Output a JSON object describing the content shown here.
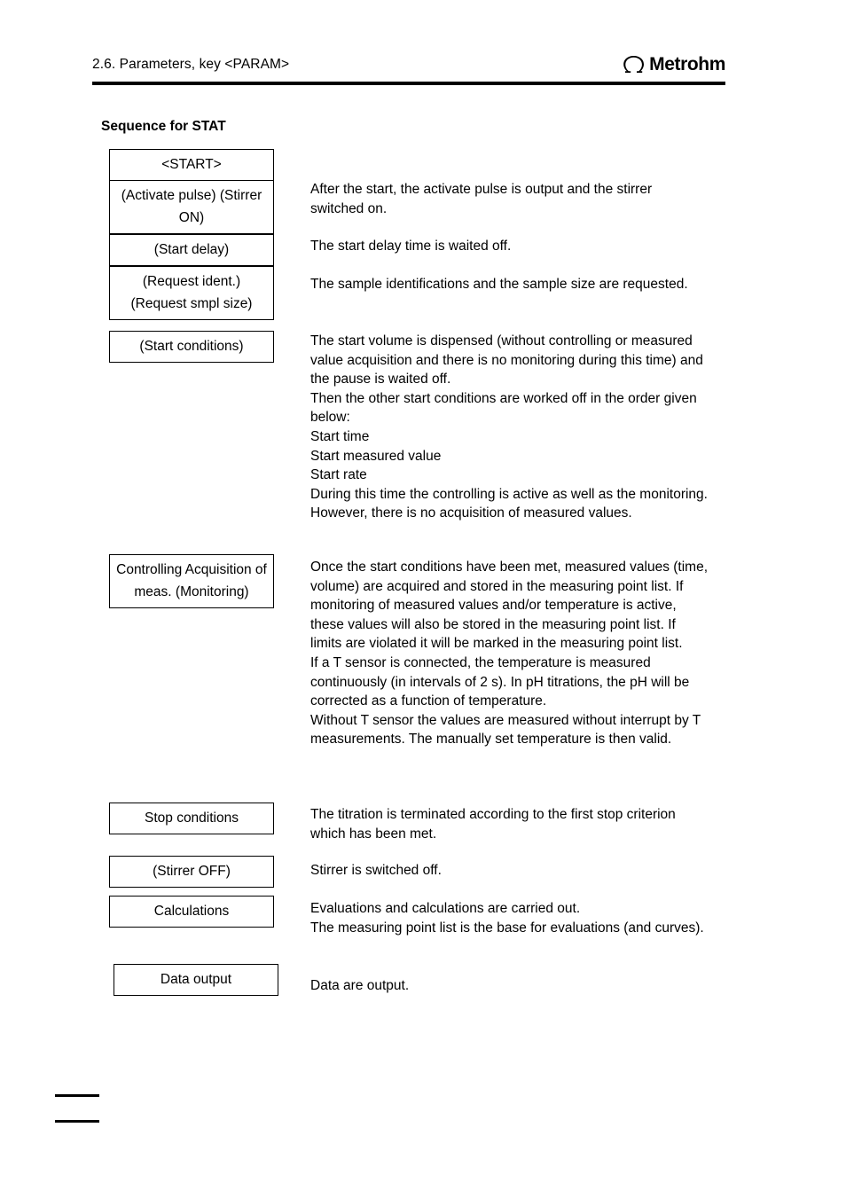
{
  "header": {
    "title": "2.6. Parameters, key <PARAM>",
    "logo_text": "Metrohm",
    "logo_symbol": "omega-symbol"
  },
  "section": {
    "heading": "Sequence for STAT"
  },
  "flow_boxes": [
    {
      "id": "start",
      "label": "<START>"
    },
    {
      "id": "activate-pulse",
      "label": "(Activate pulse)\n(Stirrer ON)"
    },
    {
      "id": "start-delay",
      "label": "(Start delay)"
    },
    {
      "id": "request-ident",
      "label": "(Request ident.)\n(Request smpl size)"
    },
    {
      "id": "start-conditions",
      "label": "(Start conditions)"
    },
    {
      "id": "controlling",
      "label": "Controlling\nAcquisition of meas.\n(Monitoring)"
    },
    {
      "id": "stop-conditions",
      "label": "Stop conditions"
    },
    {
      "id": "stirrer-off",
      "label": "(Stirrer OFF)"
    },
    {
      "id": "calculations",
      "label": "Calculations"
    },
    {
      "id": "data-output",
      "label": "Data output"
    }
  ],
  "descriptions": [
    {
      "id": "activate-pulse",
      "text": "After the start, the activate pulse is output and the stirrer switched on."
    },
    {
      "id": "start-delay",
      "text": "The start delay time is waited off."
    },
    {
      "id": "request-ident",
      "text": "The sample identifications and the sample size are requested."
    },
    {
      "id": "start-conditions",
      "text": "The start volume is dispensed (without controlling or measured value acquisition and there is no monitoring during this time) and the pause is waited off.\nThen the other start conditions are worked off in the order given below:\nStart time\nStart measured value\nStart rate\nDuring this time the controlling is active as well as the monitoring. However, there is no acquisition of measured values."
    },
    {
      "id": "controlling",
      "text": "Once the start conditions have been met, measured values (time, volume) are acquired and stored in the measuring point list. If monitoring of measured values and/or temperature is active, these values will also be stored in the measuring point list. If limits are violated it will be marked in the measuring point list.\nIf a T sensor is connected, the temperature is measured continuously (in intervals of 2 s). In pH titrations, the pH will be corrected as a function of temperature.\nWithout T sensor the values are measured without interrupt by T measurements. The manually set temperature is then valid."
    },
    {
      "id": "stop-conditions",
      "text": "The titration is terminated according to the first stop criterion which has been met."
    },
    {
      "id": "stirrer-off",
      "text": "Stirrer is switched off."
    },
    {
      "id": "calculations",
      "text": "Evaluations and calculations are carried out.\nThe measuring point list is the base for evaluations (and curves)."
    },
    {
      "id": "data-output",
      "text": "Data are output."
    }
  ]
}
